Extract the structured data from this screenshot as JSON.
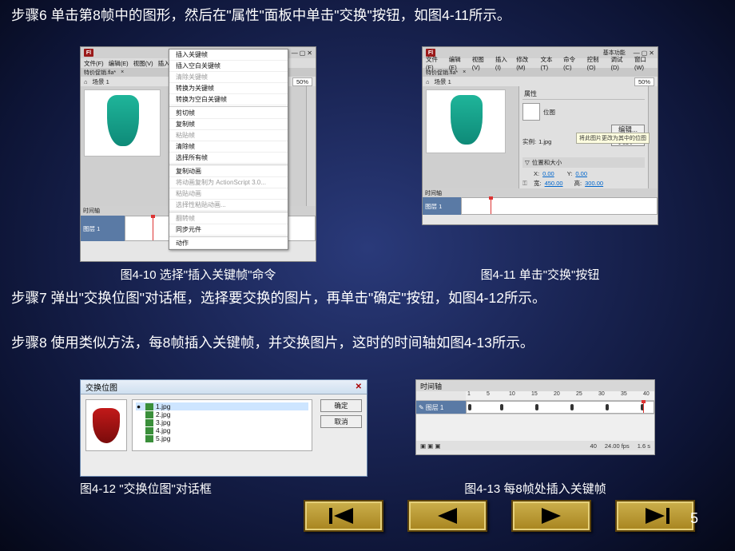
{
  "paragraphs": {
    "p6": "步骤6  单击第8帧中的图形，然后在\"属性\"面板中单击\"交换\"按钮，如图4-11所示。",
    "p7": "步骤7  弹出\"交换位图\"对话框，选择要交换的图片，再单击\"确定\"按钮，如图4-12所示。",
    "p8": "步骤8  使用类似方法，每8帧插入关键帧，并交换图片，这时的时间轴如图4-13所示。"
  },
  "captions": {
    "c10": "图4-10  选择\"插入关键帧\"命令",
    "c11": "图4-11  单击\"交换\"按钮",
    "c12": "图4-12  \"交换位图\"对话框",
    "c13": "图4-13  每8帧处插入关键帧"
  },
  "flash": {
    "logo": "Fl",
    "mode": "基本功能",
    "menus": [
      "文件(F)",
      "编辑(E)",
      "视图(V)",
      "插入(I)",
      "修改(M)",
      "文本(T)",
      "命令(C)",
      "控制(O)",
      "调试(D)",
      "窗口(W)"
    ],
    "doc_tab": "特价促销.fla*",
    "scene_row": {
      "icon": "⌂",
      "label": "场景 1",
      "zoom": "50%"
    },
    "timeline_label": "时间轴",
    "layer": "图层 1"
  },
  "context_menu": {
    "items": [
      {
        "t": "插入关键帧"
      },
      {
        "t": "插入空白关键帧"
      },
      {
        "t": "清除关键帧",
        "d": true
      },
      {
        "t": "转换为关键帧"
      },
      {
        "t": "转换为空白关键帧"
      },
      {
        "sep": true
      },
      {
        "t": "剪切帧"
      },
      {
        "t": "复制帧"
      },
      {
        "t": "粘贴帧",
        "d": true
      },
      {
        "t": "清除帧"
      },
      {
        "t": "选择所有帧"
      },
      {
        "sep": true
      },
      {
        "t": "复制动画"
      },
      {
        "t": "将动画复制为 ActionScript 3.0...",
        "d": true
      },
      {
        "t": "粘贴动画",
        "d": true
      },
      {
        "t": "选择性粘贴动画...",
        "d": true
      },
      {
        "sep": true
      },
      {
        "t": "翻转帧",
        "d": true
      },
      {
        "t": "同步元件"
      },
      {
        "sep": true
      },
      {
        "t": "动作"
      }
    ]
  },
  "prop_panel": {
    "title": "属性",
    "section": "位图",
    "instance_lbl": "实例:",
    "instance_val": "1.jpg",
    "edit_btn": "编辑...",
    "swap_btn": "交换...",
    "tooltip": "将此图片更改为其中的位图",
    "pos_size": "位置和大小",
    "x_lbl": "X:",
    "x_val": "0.00",
    "y_lbl": "Y:",
    "y_val": "0.00",
    "w_lbl": "宽:",
    "w_val": "450.00",
    "h_lbl": "高:",
    "h_val": "300.00"
  },
  "swap_dialog": {
    "title": "交换位图",
    "files": [
      "1.jpg",
      "2.jpg",
      "3.jpg",
      "4.jpg",
      "5.jpg"
    ],
    "selected": "1.jpg",
    "ok": "确定",
    "cancel": "取消"
  },
  "timeline_panel": {
    "title": "时间轴",
    "ticks": [
      "1",
      "5",
      "10",
      "15",
      "20",
      "25",
      "30",
      "35",
      "40"
    ],
    "layer": "图层 1",
    "keyframes": [
      1,
      8,
      16,
      24,
      32,
      40
    ],
    "status": {
      "frame": "40",
      "fps": "24.00 fps",
      "sec": "1.6 s"
    }
  },
  "nav": {
    "page": "5"
  }
}
